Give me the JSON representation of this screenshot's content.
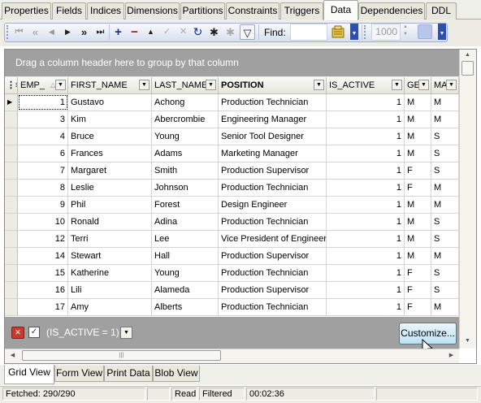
{
  "top_tabs": [
    "Properties",
    "Fields",
    "Indices",
    "Dimensions",
    "Partitions",
    "Constraints",
    "Triggers",
    "Data",
    "Dependencies",
    "DDL"
  ],
  "active_top_tab": "Data",
  "toolbar": {
    "nav_first": "⏮",
    "nav_prior_page": "«",
    "nav_prior": "◀",
    "nav_next": "▶",
    "nav_next_page": "»",
    "nav_last": "⏭",
    "insert": "+",
    "delete": "−",
    "edit": "▲",
    "post": "✓",
    "cancel": "✕",
    "refresh": "↻",
    "bookmark": "✱",
    "filter": "▽",
    "find_label": "Find:",
    "find_value": "",
    "page_value": "1000"
  },
  "grid": {
    "group_panel_text": "Drag a column header here to group by that column",
    "columns": [
      "EMP_",
      "FIRST_NAME",
      "LAST_NAME",
      "POSITION",
      "IS_ACTIVE",
      "GE",
      "MA"
    ],
    "rows": [
      [
        "1",
        "Gustavo",
        "Achong",
        "Production Technician",
        "1",
        "M",
        "M"
      ],
      [
        "3",
        "Kim",
        "Abercrombie",
        "Engineering Manager",
        "1",
        "M",
        "M"
      ],
      [
        "4",
        "Bruce",
        "Young",
        "Senior Tool Designer",
        "1",
        "M",
        "S"
      ],
      [
        "6",
        "Frances",
        "Adams",
        "Marketing Manager",
        "1",
        "M",
        "S"
      ],
      [
        "7",
        "Margaret",
        "Smith",
        "Production Supervisor",
        "1",
        "F",
        "S"
      ],
      [
        "8",
        "Leslie",
        "Johnson",
        "Production Technician",
        "1",
        "F",
        "M"
      ],
      [
        "9",
        "Phil",
        "Forest",
        "Design Engineer",
        "1",
        "M",
        "M"
      ],
      [
        "10",
        "Ronald",
        "Adina",
        "Production Technician",
        "1",
        "M",
        "S"
      ],
      [
        "12",
        "Terri",
        "Lee",
        "Vice President of Engineer",
        "1",
        "M",
        "S"
      ],
      [
        "14",
        "Stewart",
        "Hall",
        "Production Supervisor",
        "1",
        "M",
        "M"
      ],
      [
        "15",
        "Katherine",
        "Young",
        "Production Technician",
        "1",
        "F",
        "S"
      ],
      [
        "16",
        "Lili",
        "Alameda",
        "Production Supervisor",
        "1",
        "F",
        "S"
      ],
      [
        "17",
        "Amy",
        "Alberts",
        "Production Technician",
        "1",
        "F",
        "M"
      ]
    ],
    "filter_text": "(IS_ACTIVE = 1)",
    "filter_enabled": true,
    "customize_label": "Customize..."
  },
  "bottom_tabs": [
    "Grid View",
    "Form View",
    "Print Data",
    "Blob View"
  ],
  "active_bottom_tab": "Grid View",
  "status": {
    "fetched": "Fetched: 290/290",
    "blank1": "",
    "mode": "Read",
    "filtered": "Filtered",
    "time": "00:02:36"
  },
  "colors": {
    "group_panel": "#a0a0a0",
    "accent": "#2d4fb0",
    "customize": "#bfe2f6"
  }
}
